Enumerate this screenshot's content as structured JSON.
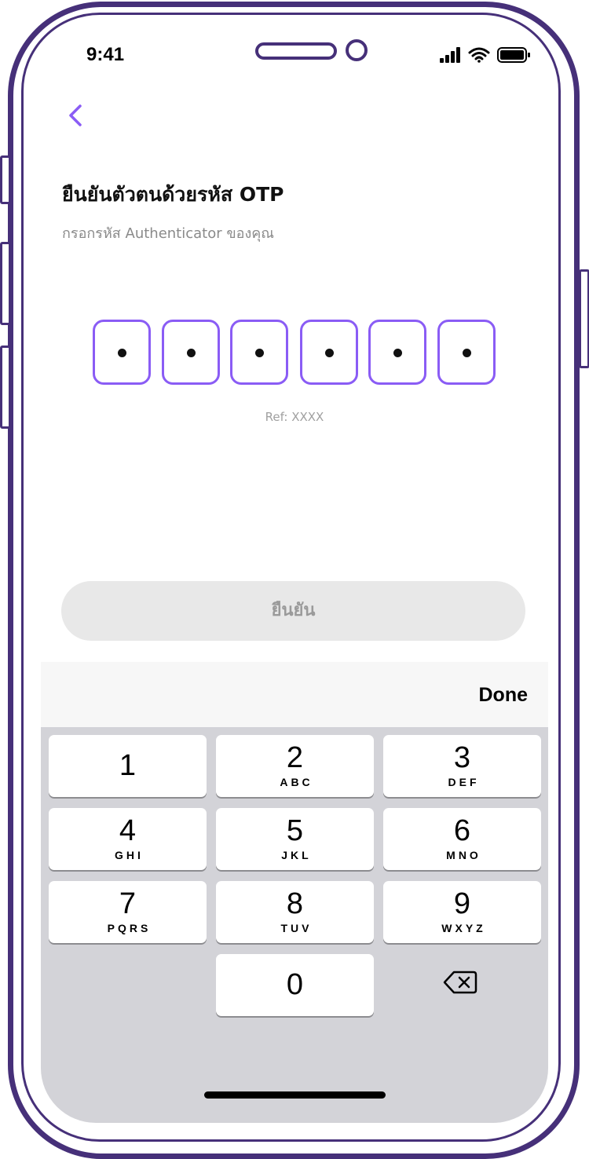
{
  "status_bar": {
    "time": "9:41"
  },
  "header": {
    "back_icon": "chevron-left-icon",
    "title": "ยืนยันตัวตนด้วยรหัส OTP",
    "subtitle": "กรอกรหัส Authenticator ของคุณ"
  },
  "otp": {
    "digit_count": 6,
    "masked_char": "•",
    "ref": "Ref: XXXX"
  },
  "confirm_button": {
    "label": "ยืนยัน"
  },
  "keyboard": {
    "done_label": "Done",
    "keys": [
      {
        "digit": "1",
        "letters": ""
      },
      {
        "digit": "2",
        "letters": "ABC"
      },
      {
        "digit": "3",
        "letters": "DEF"
      },
      {
        "digit": "4",
        "letters": "GHI"
      },
      {
        "digit": "5",
        "letters": "JKL"
      },
      {
        "digit": "6",
        "letters": "MNO"
      },
      {
        "digit": "7",
        "letters": "PQRS"
      },
      {
        "digit": "8",
        "letters": "TUV"
      },
      {
        "digit": "9",
        "letters": "WXYZ"
      },
      {
        "digit": "0",
        "letters": ""
      }
    ],
    "backspace_icon": "backspace-icon"
  },
  "colors": {
    "accent": "#8a5cf5",
    "frame": "#463079",
    "button_disabled_bg": "#e8e8e8",
    "button_disabled_text": "#9a9a9a",
    "keyboard_bg": "#d3d3d8"
  }
}
